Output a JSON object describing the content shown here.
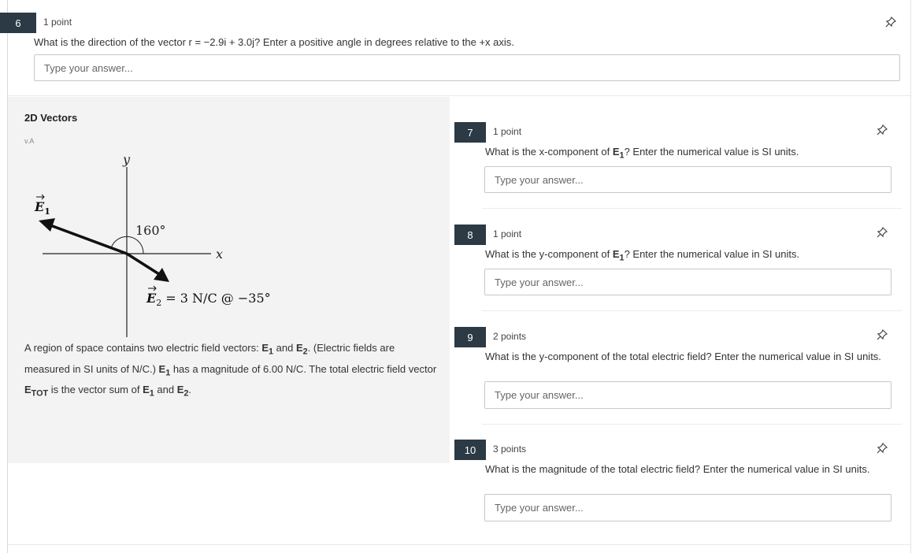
{
  "q6": {
    "number": "6",
    "points": "1 point",
    "text": "What is the direction of the vector r = −2.9i + 3.0j? Enter a positive angle in degrees relative to the +x axis.",
    "placeholder": "Type your answer..."
  },
  "section": {
    "title": "2D Vectors",
    "version": "v.A"
  },
  "diagram": {
    "y_label": "y",
    "x_label": "x",
    "e1_label": "E",
    "e1_sub": "1",
    "angle_label": "160°",
    "e2_label": "E",
    "e2_sub": "2",
    "e2_value": " = 3 N/C @ −35°"
  },
  "passage": {
    "p1": "A region of space contains two electric field vectors: ",
    "e1": "E",
    "e1_sub": "1",
    "and1": " and ",
    "e2": "E",
    "e2_sub": "2",
    "p2": ". (Electric fields are measured in SI units of N/C.) ",
    "e1b": "E",
    "e1b_sub": "1",
    "p3": " has a magnitude of 6.00 N/C. The total electric field vector ",
    "etot": "E",
    "etot_sub": "TOT",
    "p4": " is the vector sum of ",
    "e1c": "E",
    "e1c_sub": "1",
    "and2": " and ",
    "e2c": "E",
    "e2c_sub": "2",
    "p5": "."
  },
  "q7": {
    "number": "7",
    "points": "1 point",
    "pre": "What is the x-component of ",
    "bold": "E",
    "sub": "1",
    "post": "? Enter the numerical value is SI units.",
    "placeholder": "Type your answer..."
  },
  "q8": {
    "number": "8",
    "points": "1 point",
    "pre": "What is the y-component of ",
    "bold": "E",
    "sub": "1",
    "post": "? Enter the numerical value in SI units.",
    "placeholder": "Type your answer..."
  },
  "q9": {
    "number": "9",
    "points": "2 points",
    "text": "What is the y-component of the total electric field? Enter the numerical value in SI units.",
    "placeholder": "Type your answer..."
  },
  "q10": {
    "number": "10",
    "points": "3 points",
    "text": "What is the magnitude of the total electric field? Enter the numerical value in SI units.",
    "placeholder": "Type your answer..."
  },
  "icons": {
    "pin": "pin-icon"
  },
  "colors": {
    "question_badge": "#2b3a45",
    "panel_bg": "#f3f3f3"
  }
}
